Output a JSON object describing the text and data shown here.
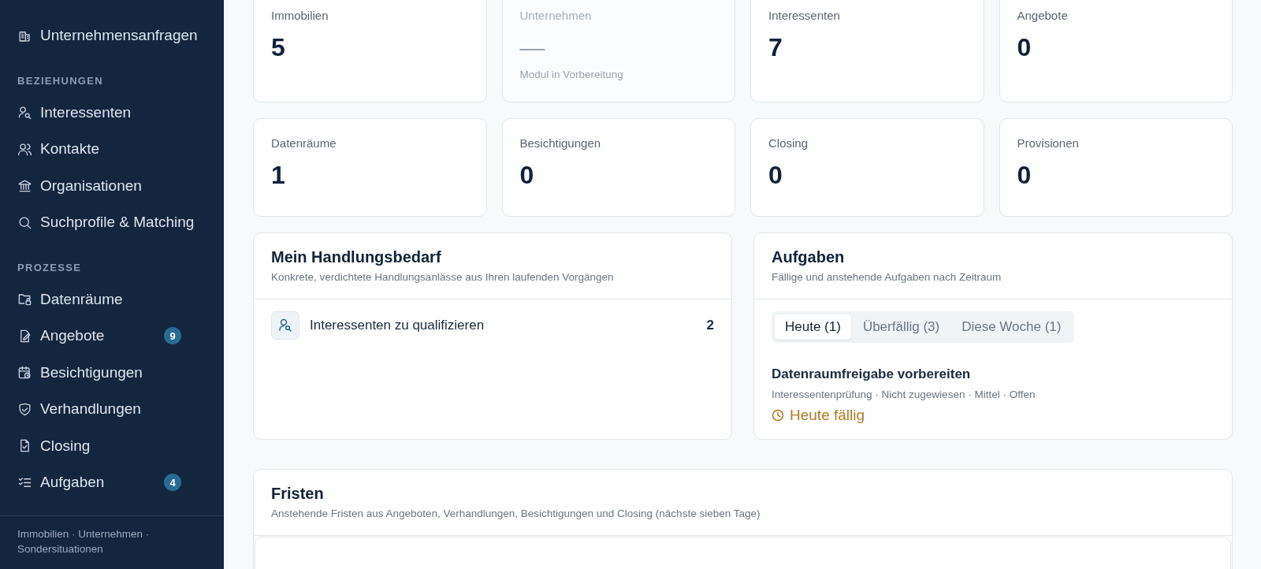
{
  "sidebar": {
    "sections": [
      {
        "items": [
          {
            "label": "Unternehmensanfragen"
          }
        ]
      },
      {
        "heading": "BEZIEHUNGEN",
        "items": [
          {
            "label": "Interessenten"
          },
          {
            "label": "Kontakte"
          },
          {
            "label": "Organisationen"
          },
          {
            "label": "Suchprofile & Matching"
          }
        ]
      },
      {
        "heading": "PROZESSE",
        "items": [
          {
            "label": "Datenräume"
          },
          {
            "label": "Angebote",
            "badge": "9"
          },
          {
            "label": "Besichtigungen"
          },
          {
            "label": "Verhandlungen"
          },
          {
            "label": "Closing"
          },
          {
            "label": "Aufgaben",
            "badge": "4"
          }
        ]
      }
    ],
    "footer": "Immobilien · Unternehmen · Sondersituationen"
  },
  "stats": [
    {
      "label": "Immobilien",
      "value": "5",
      "disabled": false
    },
    {
      "label": "Unternehmen",
      "value": "—",
      "note": "Modul in Vorbereitung",
      "disabled": true
    },
    {
      "label": "Interessenten",
      "value": "7",
      "disabled": false
    },
    {
      "label": "Angebote",
      "value": "0",
      "disabled": false
    },
    {
      "label": "Datenräume",
      "value": "1",
      "disabled": false
    },
    {
      "label": "Besichtigungen",
      "value": "0",
      "disabled": false
    },
    {
      "label": "Closing",
      "value": "0",
      "disabled": false
    },
    {
      "label": "Provisionen",
      "value": "0",
      "disabled": false
    }
  ],
  "actions_panel": {
    "title": "Mein Handlungsbedarf",
    "subtitle": "Konkrete, verdichtete Handlungsanlässe aus Ihren laufenden Vorgängen",
    "items": [
      {
        "label": "Interessenten zu qualifizieren",
        "count": "2"
      }
    ]
  },
  "tasks_panel": {
    "title": "Aufgaben",
    "subtitle": "Fällige und anstehende Aufgaben nach Zeitraum",
    "tabs": [
      {
        "label": "Heute (1)",
        "selected": true
      },
      {
        "label": "Überfällig (3)",
        "selected": false
      },
      {
        "label": "Diese Woche (1)",
        "selected": false
      }
    ],
    "tasks": [
      {
        "title": "Datenraumfreigabe vorbereiten",
        "meta": "Interessentenprüfung · Nicht zugewiesen · Mittel · Offen",
        "due": "Heute fällig"
      }
    ]
  },
  "deadlines_panel": {
    "title": "Fristen",
    "subtitle": "Anstehende Fristen aus Angeboten, Verhandlungen, Besichtigungen und Closing (nächste sieben Tage)"
  }
}
